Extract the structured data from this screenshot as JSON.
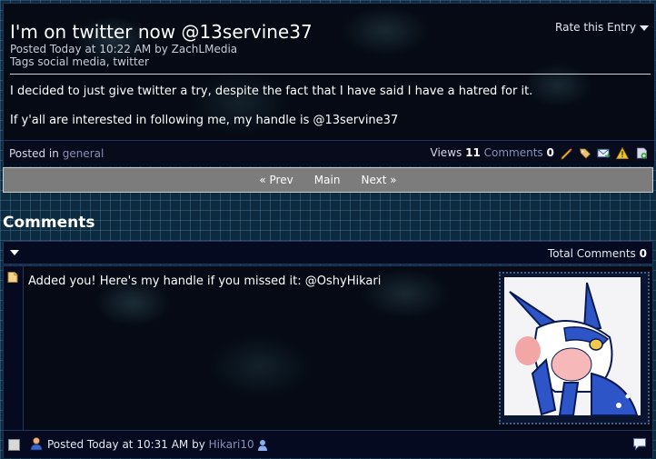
{
  "entry": {
    "title": "I'm on twitter now @13servine37",
    "posted_label": "Posted Today at 10:22 AM by ZachLMedia",
    "tags_label": "Tags social media, twitter",
    "rate_label": "Rate this Entry",
    "body": [
      "I decided to just give twitter a try, despite the fact that I have said I have a hatred for it.",
      "If y'all are interested in following me, my handle is @13servine37"
    ],
    "footer": {
      "posted_in_label": "Posted in",
      "category": "general",
      "views_label": "Views",
      "views_count": "11",
      "comments_label": "Comments",
      "comments_count": "0"
    }
  },
  "nav": {
    "prev": "« Prev",
    "main": "Main",
    "next": "Next »"
  },
  "comments": {
    "heading": "Comments",
    "total_label": "Total Comments",
    "total_count": "0",
    "items": [
      {
        "text": "Added you! Here's my handle if you missed it: @OshyHikari",
        "posted_prefix": "Posted Today at 10:31 AM by",
        "author": "Hikari10"
      }
    ]
  },
  "icons": {
    "toolbar": [
      "pencil-icon",
      "tag-icon",
      "email-icon",
      "warning-icon",
      "bookmark-icon"
    ],
    "comment": [
      "user-icon",
      "online-user-icon",
      "reply-icon"
    ]
  },
  "colors": {
    "link": "#8a8fb5",
    "nav_bar": "#7c7c7c",
    "page_grid": "#0c2a40"
  }
}
